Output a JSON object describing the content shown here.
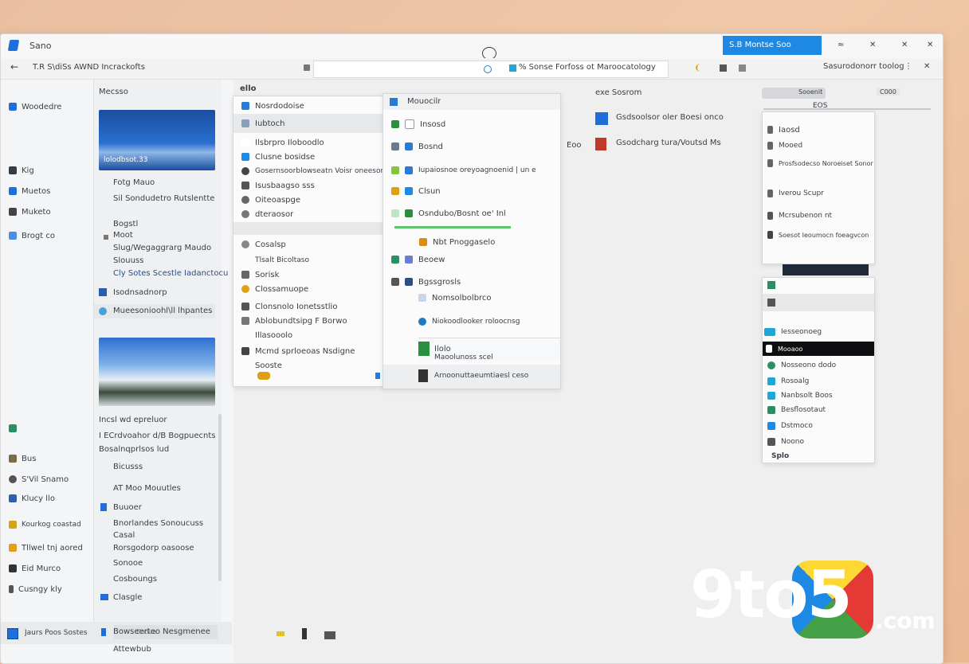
{
  "window": {
    "title": "Sano",
    "search_box": "S.B Montse Soo",
    "title_controls": [
      "≈",
      "✕",
      "✕",
      "✕"
    ]
  },
  "address": {
    "back_label": "←",
    "path": "T.R S\\diSs AWND Incrackofts",
    "url_text": "% Sonse Forfoss ot Maroocatology",
    "right_text": "Sasurodonorr toolog"
  },
  "left_sidebar": {
    "top_label": "Woodedre",
    "items": [
      {
        "label": "Kig",
        "color": "#333b44"
      },
      {
        "label": "Muetos",
        "color": "#1e6fd9"
      },
      {
        "label": "Muketo",
        "color": "#444"
      },
      {
        "label": "Brogt co",
        "color": "#4a90e2"
      }
    ],
    "bottom_items": [
      {
        "label": "",
        "color": "#2a8f62"
      },
      {
        "label": "Bus",
        "color": "#7a6d4b"
      },
      {
        "label": "S'Vil Snamo",
        "color": "#555"
      },
      {
        "label": "Klucy llo",
        "color": "#2d5fae"
      },
      {
        "label": "Kourkog coastad",
        "color": "#d9a21b"
      },
      {
        "label": "Tllwel tnj aored",
        "color": "#e0a016"
      },
      {
        "label": "Eid Murco",
        "color": "#333"
      },
      {
        "label": "Cusngy kly",
        "color": "#555"
      }
    ],
    "taskbar_label": "Jaurs Poos Sostes"
  },
  "nav_column": {
    "header": "Mecsso",
    "thumb1_caption": "lolodbsot.33",
    "items": [
      "Fotg Mauo",
      "Sil Sondudetro Rutslentte",
      "Bogstl",
      "Moot",
      "Slug/Wegaggrarg Maudo",
      "Slouuss",
      "Cly Sotes Scestle Iadanctocu",
      "Isodnsadnorp",
      "Mueesonioohl\\ll lhpantes"
    ],
    "lower_items": [
      "Incsl wd epreluor",
      "I ECrdvoahor d/B Bogpuecnts",
      "Bosalnqprlsos lud",
      "Bicusss",
      "AT Moo Mouutles",
      "Buuoer",
      "Bnorlandes Sonoucuss",
      "Casal",
      "Rorsgodorp oasoose",
      "Sonooe",
      "Cosboungs",
      "Clasgle",
      "Bowseerteo Nesgmenee",
      "Attewbub"
    ],
    "bottom_field": "Cooue"
  },
  "content_header": "ello",
  "menu1": {
    "items": [
      {
        "label": "Nosrdodoise",
        "icon": "#2a7ad6"
      },
      {
        "label": "Iubtoch",
        "icon": "#8aa0b8"
      },
      {
        "label": "Ilsbrpro Iloboodlo",
        "icon": "#aaa"
      },
      {
        "label": "Clusne bosidse",
        "icon": "#1e88e5"
      },
      {
        "label": "Gosernsoorblowseatn Voisr oneesonlo",
        "icon": "#444"
      },
      {
        "label": "Isusbaagso sss",
        "icon": "#555"
      },
      {
        "label": "Oiteoaspge",
        "icon": "#666"
      },
      {
        "label": "dteraosor",
        "icon": "#777"
      },
      {
        "label": "Cosalsp",
        "icon": "#888"
      },
      {
        "label": "Tlsalt Bicoltaso",
        "icon": "#aaa"
      },
      {
        "label": "Sorisk",
        "icon": "#666"
      },
      {
        "label": "Clossamuope",
        "icon": "#e0a016"
      },
      {
        "label": "Clonsnolo Ionetsstlio",
        "icon": "#555"
      },
      {
        "label": "Ablobundtsipg F Borwo",
        "icon": "#777"
      },
      {
        "label": "Illasooolo",
        "icon": "#999"
      },
      {
        "label": "Mcmd sprloeoas Nsdigne",
        "icon": "#444"
      },
      {
        "label": "Sooste",
        "icon": "#666"
      }
    ]
  },
  "menu2": {
    "header": "Mouocilr",
    "items": [
      {
        "label": "Insosd",
        "icon": "#2a8f3c"
      },
      {
        "label": "Bosnd",
        "icon": "#2a7ad6"
      },
      {
        "label": "Iupaiosnoe oreyoagnoenid | un e",
        "icon": "#2a7ad6"
      },
      {
        "label": "Clsun",
        "icon": "#1e88e5"
      },
      {
        "label": "Osndubo/Bosnt oe' Inl",
        "icon": "#2a8f3c"
      },
      {
        "label": "Nbt Pnoggaselo",
        "icon": "#e08a16"
      },
      {
        "label": "Beoew",
        "icon": "#6a7dcf"
      },
      {
        "label": "Bgssgrosls",
        "icon": "#2a4f86"
      },
      {
        "label": "Nomsolbolbrco",
        "icon": "#88a"
      },
      {
        "label": "Niokoodlooker roloocnsg",
        "icon": "#1f7ac0"
      },
      {
        "label": "Ilolo",
        "icon": "#2a8f3c"
      },
      {
        "label": "Maoolunoss scel",
        "icon": "#555"
      },
      {
        "label": "Arnoonuttaeumtiaesl ceso",
        "icon": "#333"
      }
    ]
  },
  "right_links": {
    "title": "exe Sosrom",
    "items": [
      {
        "label": "Gsdsoolsor oler Boesi onco",
        "icon": "#1e6fd9"
      },
      {
        "label": "Gsodcharg tura/Voutsd Ms",
        "icon": "#c0392b"
      }
    ],
    "left_label": "Eoo"
  },
  "menu3": {
    "top_tab": "C000",
    "top_text": "Sooenit",
    "badge": "EOS",
    "items": [
      {
        "label": "Iaosd",
        "icon": "#666"
      },
      {
        "label": "Mooed",
        "icon": "#666"
      },
      {
        "label": "Prosfsodecso Noroeiset Sonor",
        "icon": "#666"
      },
      {
        "label": "Iverou Scupr",
        "icon": "#666"
      },
      {
        "label": "Mcrsubenon nt",
        "icon": "#555"
      },
      {
        "label": "Soesot Ieoumocn foeagvcon",
        "icon": "#444"
      }
    ],
    "lower_items": [
      {
        "label": "Iesseonoeg",
        "icon": "#1ea7d8"
      },
      {
        "label": "Mooaoo",
        "icon": "#fff",
        "selected": true
      },
      {
        "label": "Nosseono dodo",
        "icon": "#2a8f62"
      },
      {
        "label": "Rosoalg",
        "icon": "#1ea7d8"
      },
      {
        "label": "Nanbsolt Boos",
        "icon": "#1ea7d8"
      },
      {
        "label": "Besflosotaut",
        "icon": "#2a8f62"
      },
      {
        "label": "Dstmoco",
        "icon": "#1e88e5"
      },
      {
        "label": "Noono",
        "icon": "#555"
      },
      {
        "label": "Splo",
        "icon": "#2a8f62"
      }
    ]
  },
  "watermark": {
    "brand": "9to5",
    "domain": ".com"
  }
}
